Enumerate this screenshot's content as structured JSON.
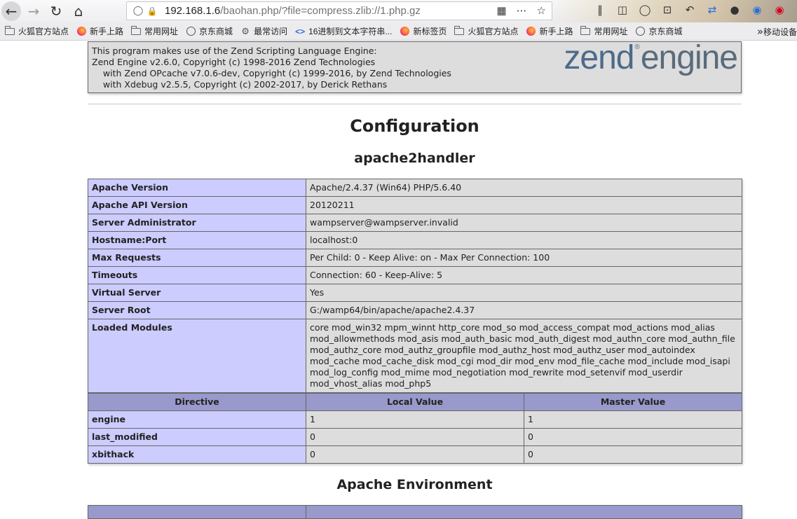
{
  "browser": {
    "url_host": "192.168.1.6",
    "url_path": "/baohan.php/?file=compress.zlib://1.php.gz",
    "bookmarks": [
      {
        "label": "火狐官方站点",
        "icon": "folder-icon"
      },
      {
        "label": "新手上路",
        "icon": "firefox-icon"
      },
      {
        "label": "常用网址",
        "icon": "folder-icon"
      },
      {
        "label": "京东商城",
        "icon": "globe-icon"
      },
      {
        "label": "最常访问",
        "icon": "gear-icon"
      },
      {
        "label": "16进制到文本字符串...",
        "icon": "code-icon"
      },
      {
        "label": "新标签页",
        "icon": "firefox-icon"
      },
      {
        "label": "火狐官方站点",
        "icon": "folder-icon"
      },
      {
        "label": "新手上路",
        "icon": "firefox-icon"
      },
      {
        "label": "常用网址",
        "icon": "folder-icon"
      },
      {
        "label": "京东商城",
        "icon": "globe-icon"
      }
    ],
    "bookmark_last": "移动设备"
  },
  "zend": {
    "lines": [
      "This program makes use of the Zend Scripting Language Engine:",
      "Zend Engine v2.6.0, Copyright (c) 1998-2016 Zend Technologies",
      "    with Zend OPcache v7.0.6-dev, Copyright (c) 1999-2016, by Zend Technologies",
      "    with Xdebug v2.5.5, Copyright (c) 2002-2017, by Derick Rethans"
    ],
    "logo_zend": "zend",
    "logo_engine": "engine"
  },
  "headings": {
    "configuration": "Configuration",
    "apache2handler": "apache2handler",
    "apache_env": "Apache Environment"
  },
  "apache_table": [
    {
      "key": "Apache Version",
      "value": "Apache/2.4.37 (Win64) PHP/5.6.40"
    },
    {
      "key": "Apache API Version",
      "value": "20120211"
    },
    {
      "key": "Server Administrator",
      "value": "wampserver@wampserver.invalid"
    },
    {
      "key": "Hostname:Port",
      "value": "localhost:0"
    },
    {
      "key": "Max Requests",
      "value": "Per Child: 0 - Keep Alive: on - Max Per Connection: 100"
    },
    {
      "key": "Timeouts",
      "value": "Connection: 60 - Keep-Alive: 5"
    },
    {
      "key": "Virtual Server",
      "value": "Yes"
    },
    {
      "key": "Server Root",
      "value": "G:/wamp64/bin/apache/apache2.4.37"
    },
    {
      "key": "Loaded Modules",
      "value": "core mod_win32 mpm_winnt http_core mod_so mod_access_compat mod_actions mod_alias mod_allowmethods mod_asis mod_auth_basic mod_auth_digest mod_authn_core mod_authn_file mod_authz_core mod_authz_groupfile mod_authz_host mod_authz_user mod_autoindex mod_cache mod_cache_disk mod_cgi mod_dir mod_env mod_file_cache mod_include mod_isapi mod_log_config mod_mime mod_negotiation mod_rewrite mod_setenvif mod_userdir mod_vhost_alias mod_php5"
    }
  ],
  "directive_table": {
    "headers": [
      "Directive",
      "Local Value",
      "Master Value"
    ],
    "rows": [
      [
        "engine",
        "1",
        "1"
      ],
      [
        "last_modified",
        "0",
        "0"
      ],
      [
        "xbithack",
        "0",
        "0"
      ]
    ]
  }
}
